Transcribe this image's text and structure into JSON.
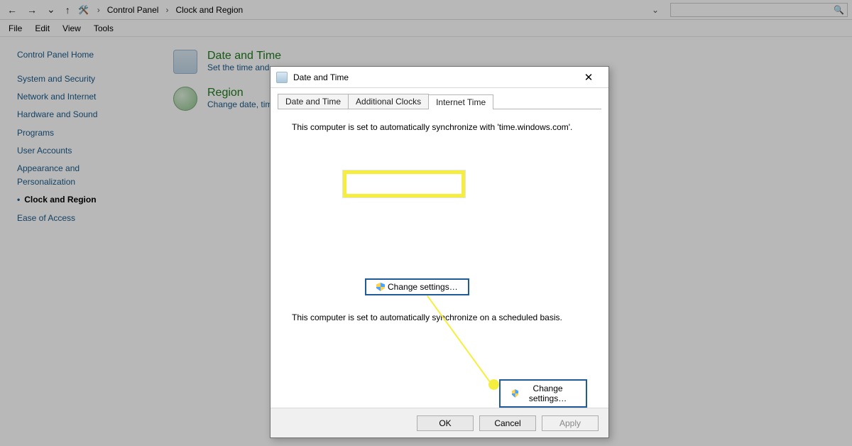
{
  "breadcrumb": {
    "root": "Control Panel",
    "current": "Clock and Region"
  },
  "menubar": [
    "File",
    "Edit",
    "View",
    "Tools"
  ],
  "sidebar": {
    "home": "Control Panel Home",
    "items": [
      {
        "label": "System and Security"
      },
      {
        "label": "Network and Internet"
      },
      {
        "label": "Hardware and Sound"
      },
      {
        "label": "Programs"
      },
      {
        "label": "User Accounts"
      },
      {
        "label": "Appearance and Personalization"
      },
      {
        "label": "Clock and Region",
        "current": true
      },
      {
        "label": "Ease of Access"
      }
    ]
  },
  "content": {
    "date_time": {
      "title": "Date and Time",
      "sub": "Set the time and"
    },
    "region": {
      "title": "Region",
      "sub": "Change date, tim"
    }
  },
  "dialog": {
    "title": "Date and Time",
    "tabs": {
      "t0": "Date and Time",
      "t1": "Additional Clocks",
      "t2": "Internet Time"
    },
    "sync_text": "This computer is set to automatically synchronize with 'time.windows.com'.",
    "sched_text": "This computer is set to automatically synchronize on a scheduled basis.",
    "change_settings": "Change settings…",
    "ok": "OK",
    "cancel": "Cancel",
    "apply": "Apply"
  }
}
